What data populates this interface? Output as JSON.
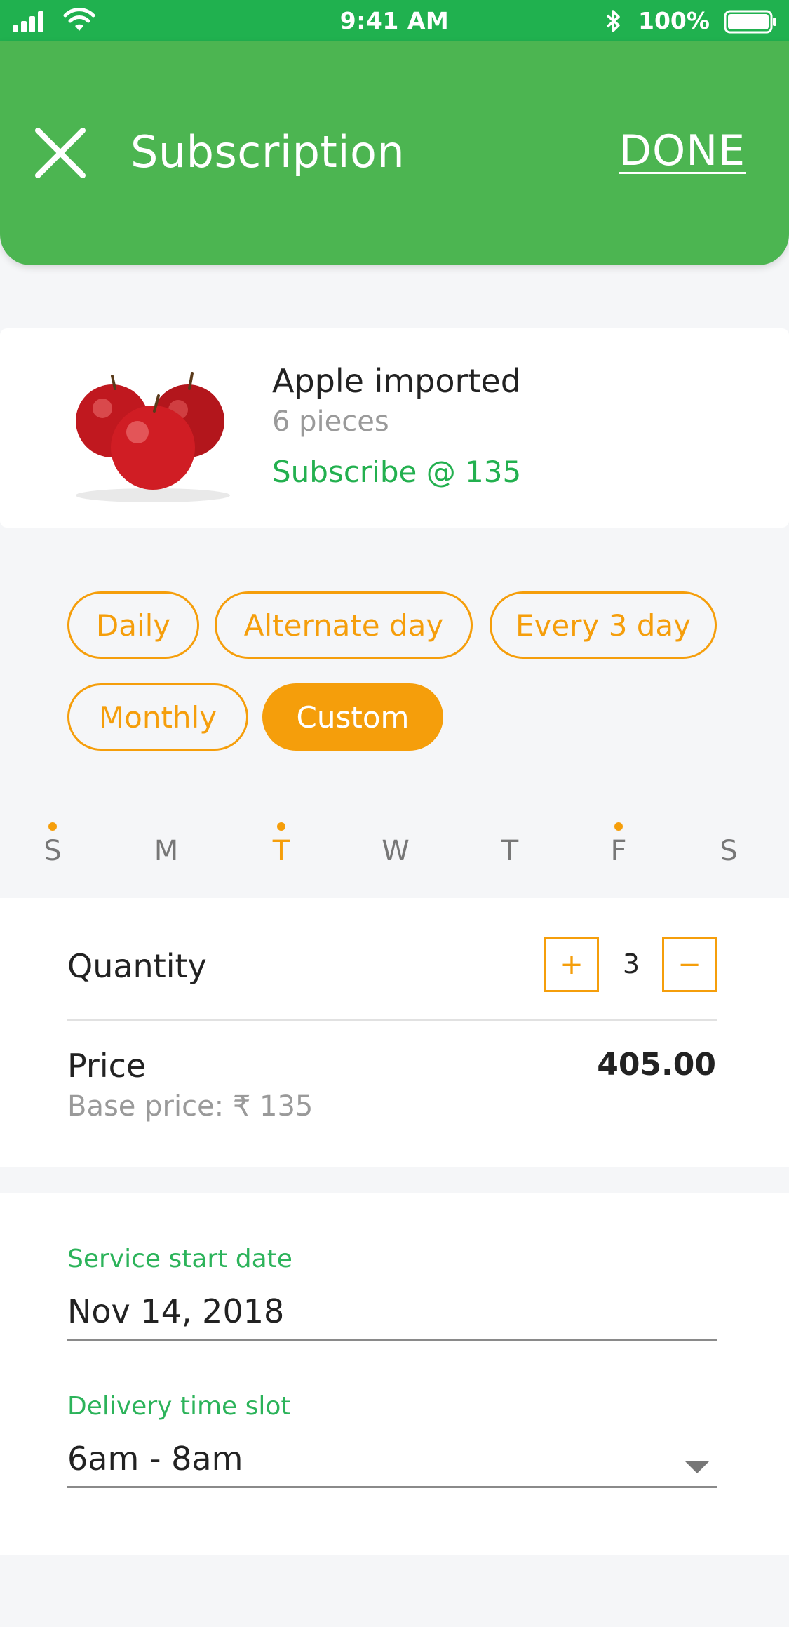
{
  "status_bar": {
    "time": "9:41 AM",
    "battery_percent": "100%",
    "icons": [
      "signal-icon",
      "wifi-icon",
      "bluetooth-icon",
      "battery-icon"
    ]
  },
  "header": {
    "title": "Subscription",
    "done_label": "DONE",
    "close_icon": "close-icon",
    "background_color": "#4cb551"
  },
  "product": {
    "name": "Apple imported",
    "quantity_text": "6 pieces",
    "subscribe_text": "Subscribe @ 135",
    "image_icon": "apples-image"
  },
  "frequency_options": [
    {
      "label": "Daily",
      "selected": false
    },
    {
      "label": "Alternate day",
      "selected": false
    },
    {
      "label": "Every 3 day",
      "selected": false
    },
    {
      "label": "Monthly",
      "selected": false
    },
    {
      "label": "Custom",
      "selected": true
    }
  ],
  "weekdays": [
    {
      "label": "S",
      "marked": true,
      "active": false
    },
    {
      "label": "M",
      "marked": false,
      "active": false
    },
    {
      "label": "T",
      "marked": true,
      "active": true
    },
    {
      "label": "W",
      "marked": false,
      "active": false
    },
    {
      "label": "T",
      "marked": false,
      "active": false
    },
    {
      "label": "F",
      "marked": true,
      "active": false
    },
    {
      "label": "S",
      "marked": false,
      "active": false
    }
  ],
  "quantity": {
    "label": "Quantity",
    "value": "3",
    "plus_label": "+",
    "minus_label": "−"
  },
  "price": {
    "label": "Price",
    "value": "405.00",
    "base_label": "Base price:  ₹ 135"
  },
  "service": {
    "start_date_label": "Service start date",
    "start_date_value": "Nov 14, 2018",
    "time_slot_label": "Delivery time slot",
    "time_slot_value": "6am - 8am"
  },
  "colors": {
    "brand_green": "#4cb551",
    "status_green": "#20b14f",
    "accent_orange": "#f59e0b",
    "text_green": "#23b04f"
  }
}
